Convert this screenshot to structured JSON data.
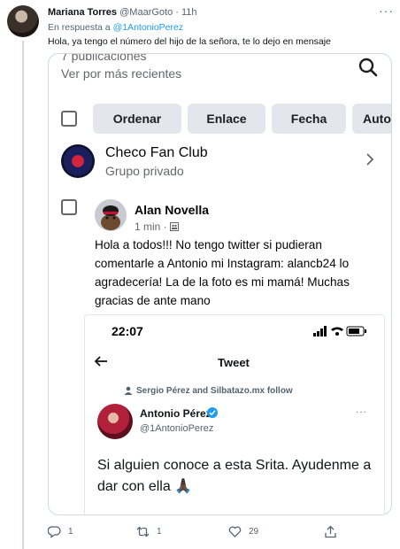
{
  "tweet": {
    "author_name": "Mariana Torres",
    "author_handle": "@MaarGoto",
    "separator": "·",
    "time": "11h",
    "more": "···",
    "reply_prefix": "En respuesta a",
    "reply_to": "@1AntonioPerez",
    "text": "Hola, ya tengo el número del hijo de la señora, te lo dejo en mensaje"
  },
  "media": {
    "top_partial": "7 publicaciones",
    "sort_label": "Ver por más recientes",
    "chips": [
      "Ordenar",
      "Enlace",
      "Fecha",
      "Auto"
    ],
    "group": {
      "name": "Checo Fan Club",
      "privacy": "Grupo privado"
    },
    "post": {
      "author": "Alan Novella",
      "meta": "1 min · ",
      "body": "Hola a todos!!! No tengo twitter si pudieran comentarle a Antonio mi Instagram: alancb24 lo agradecería! La de la foto es mi mamá! Muchas gracias de ante mano"
    },
    "screenshot": {
      "time": "22:07",
      "title": "Tweet",
      "followed_by": "Sergio Pérez and Silbatazo.mx follow",
      "name": "Antonio Pérez",
      "handle": "@1AntonioPerez",
      "dots": "···",
      "text": "Si alguien conoce a esta Srita. Ayudenme a dar con ella 🙏🏿"
    }
  },
  "actions": {
    "reply_count": "1",
    "retweet_count": "1",
    "like_count": "29"
  },
  "colors": {
    "accent": "#1d9bf0",
    "muted": "#536471",
    "border": "#cfd9de",
    "chip": "#e4e6eb"
  },
  "icons": [
    "reply-icon",
    "retweet-icon",
    "like-icon",
    "share-icon",
    "search-icon",
    "chevron-right-icon",
    "verified-icon",
    "back-arrow-icon",
    "person-icon"
  ]
}
